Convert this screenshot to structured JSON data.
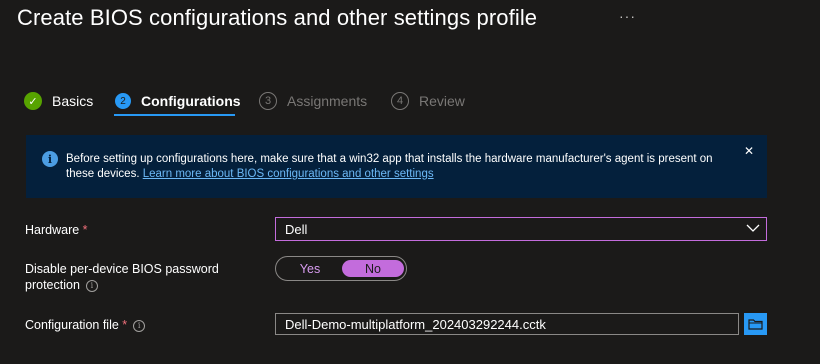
{
  "page": {
    "title": "Create BIOS configurations and other settings profile",
    "more_label": "···"
  },
  "steps": [
    {
      "number": "✓",
      "label": "Basics",
      "state": "done"
    },
    {
      "number": "2",
      "label": "Configurations",
      "state": "active"
    },
    {
      "number": "3",
      "label": "Assignments",
      "state": "pending"
    },
    {
      "number": "4",
      "label": "Review",
      "state": "pending"
    }
  ],
  "banner": {
    "icon": "info-icon",
    "message": "Before setting up configurations here, make sure that a win32 app that installs the hardware manufacturer's agent is present on these devices.",
    "link": "Learn more about BIOS configurations and other settings",
    "close_label": "✕"
  },
  "form": {
    "hardware": {
      "label": "Hardware",
      "required_mark": "*",
      "value": "Dell"
    },
    "password_protection": {
      "label": "Disable per-device BIOS password protection",
      "options": [
        "Yes",
        "No"
      ],
      "selected": "No"
    },
    "configuration_file": {
      "label": "Configuration file",
      "required_mark": "*",
      "value": "Dell-Demo-multiplatform_202403292244.cctk"
    }
  },
  "colors": {
    "background": "#1b1a19",
    "accent": "#2899f5",
    "toggle_accent": "#c36cdc",
    "success": "#57a300",
    "banner_bg": "#04203c",
    "required": "#f1707b"
  }
}
